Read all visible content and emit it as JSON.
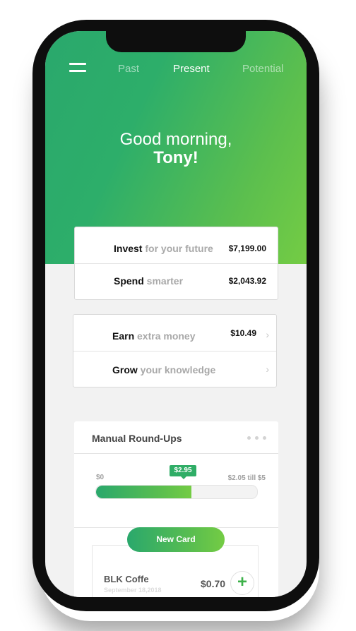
{
  "nav": {
    "tabs": [
      {
        "label": "Past",
        "active": false
      },
      {
        "label": "Present",
        "active": true
      },
      {
        "label": "Potential",
        "active": false
      }
    ]
  },
  "greeting": {
    "line1": "Good morning,",
    "name": "Tony!"
  },
  "summary": [
    {
      "title": "Invest",
      "subtitle": "for your future",
      "amount": "$7,199.00"
    },
    {
      "title": "Spend",
      "subtitle": "smarter",
      "amount": "$2,043.92"
    }
  ],
  "actions": [
    {
      "title": "Earn",
      "subtitle": "extra money",
      "amount": "$10.49"
    },
    {
      "title": "Grow",
      "subtitle": "your knowledge"
    }
  ],
  "roundups": {
    "title": "Manual Round-Ups",
    "min_label": "$0",
    "current": "$2.95",
    "remaining": "$2.05 till $5",
    "progress": 0.59,
    "button": "New Card"
  },
  "transaction": {
    "merchant": "BLK Coffe",
    "date": "September 18,2018",
    "amount": "$0.70"
  },
  "colors": {
    "accent_start": "#2aa86c",
    "accent_end": "#74cc44"
  },
  "icons": {
    "menu": "hamburger-menu-icon",
    "more": "more-dots-icon",
    "chevron": "chevron-right-icon",
    "add": "plus-icon"
  }
}
